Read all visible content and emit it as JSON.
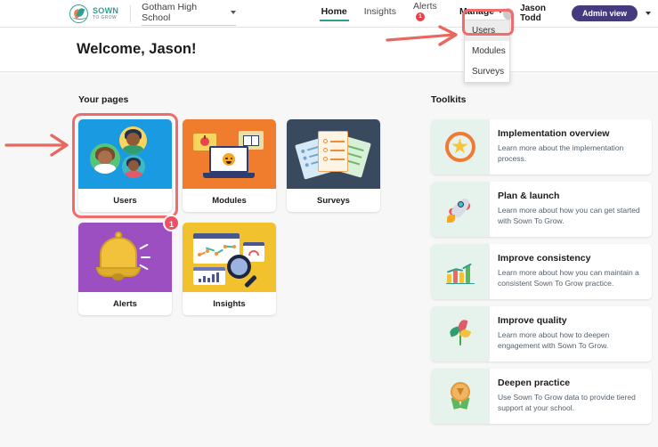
{
  "app": {
    "logo_line1": "SOWN",
    "logo_line2": "TO GROW"
  },
  "header": {
    "school_selector": "Gotham High School",
    "nav": [
      {
        "label": "Home",
        "active": true,
        "badge": ""
      },
      {
        "label": "Insights",
        "active": false,
        "badge": ""
      },
      {
        "label": "Alerts",
        "active": false,
        "badge": "1"
      },
      {
        "label": "Manage",
        "active": false,
        "badge": "",
        "has_caret": true
      }
    ],
    "user_name": "Jason Todd",
    "admin_view_label": "Admin view"
  },
  "manage_menu": {
    "items": [
      {
        "label": "Users",
        "selected": true
      },
      {
        "label": "Modules",
        "selected": false
      },
      {
        "label": "Surveys",
        "selected": false
      }
    ]
  },
  "welcome": {
    "title": "Welcome, Jason!"
  },
  "your_pages": {
    "section_label": "Your pages",
    "cards": [
      {
        "label": "Users",
        "color": "#1a9ae0",
        "highlighted": true,
        "badge": ""
      },
      {
        "label": "Modules",
        "color": "#ef7d2d",
        "highlighted": false,
        "badge": ""
      },
      {
        "label": "Surveys",
        "color": "#3a4a5e",
        "highlighted": false,
        "badge": ""
      },
      {
        "label": "Alerts",
        "color": "#9b4fc0",
        "highlighted": false,
        "badge": "1"
      },
      {
        "label": "Insights",
        "color": "#f2c12e",
        "highlighted": false,
        "badge": ""
      }
    ]
  },
  "toolkits": {
    "section_label": "Toolkits",
    "items": [
      {
        "title": "Implementation overview",
        "desc": "Learn more about the implementation process.",
        "icon": "star-badge-icon"
      },
      {
        "title": "Plan & launch",
        "desc": "Learn more about how you can get started with Sown To Grow.",
        "icon": "rocket-icon"
      },
      {
        "title": "Improve consistency",
        "desc": "Learn more about how you can maintain a consistent Sown To Grow practice.",
        "icon": "bar-chart-icon"
      },
      {
        "title": "Improve quality",
        "desc": "Learn more about how to deepen engagement with Sown To Grow.",
        "icon": "plant-icon"
      },
      {
        "title": "Deepen practice",
        "desc": "Use Sown To Grow data to provide tiered support at your school.",
        "icon": "award-ribbon-icon"
      }
    ]
  },
  "annotations": {
    "arrow_color": "#e8685f",
    "highlight_color": "#f06b6b"
  }
}
